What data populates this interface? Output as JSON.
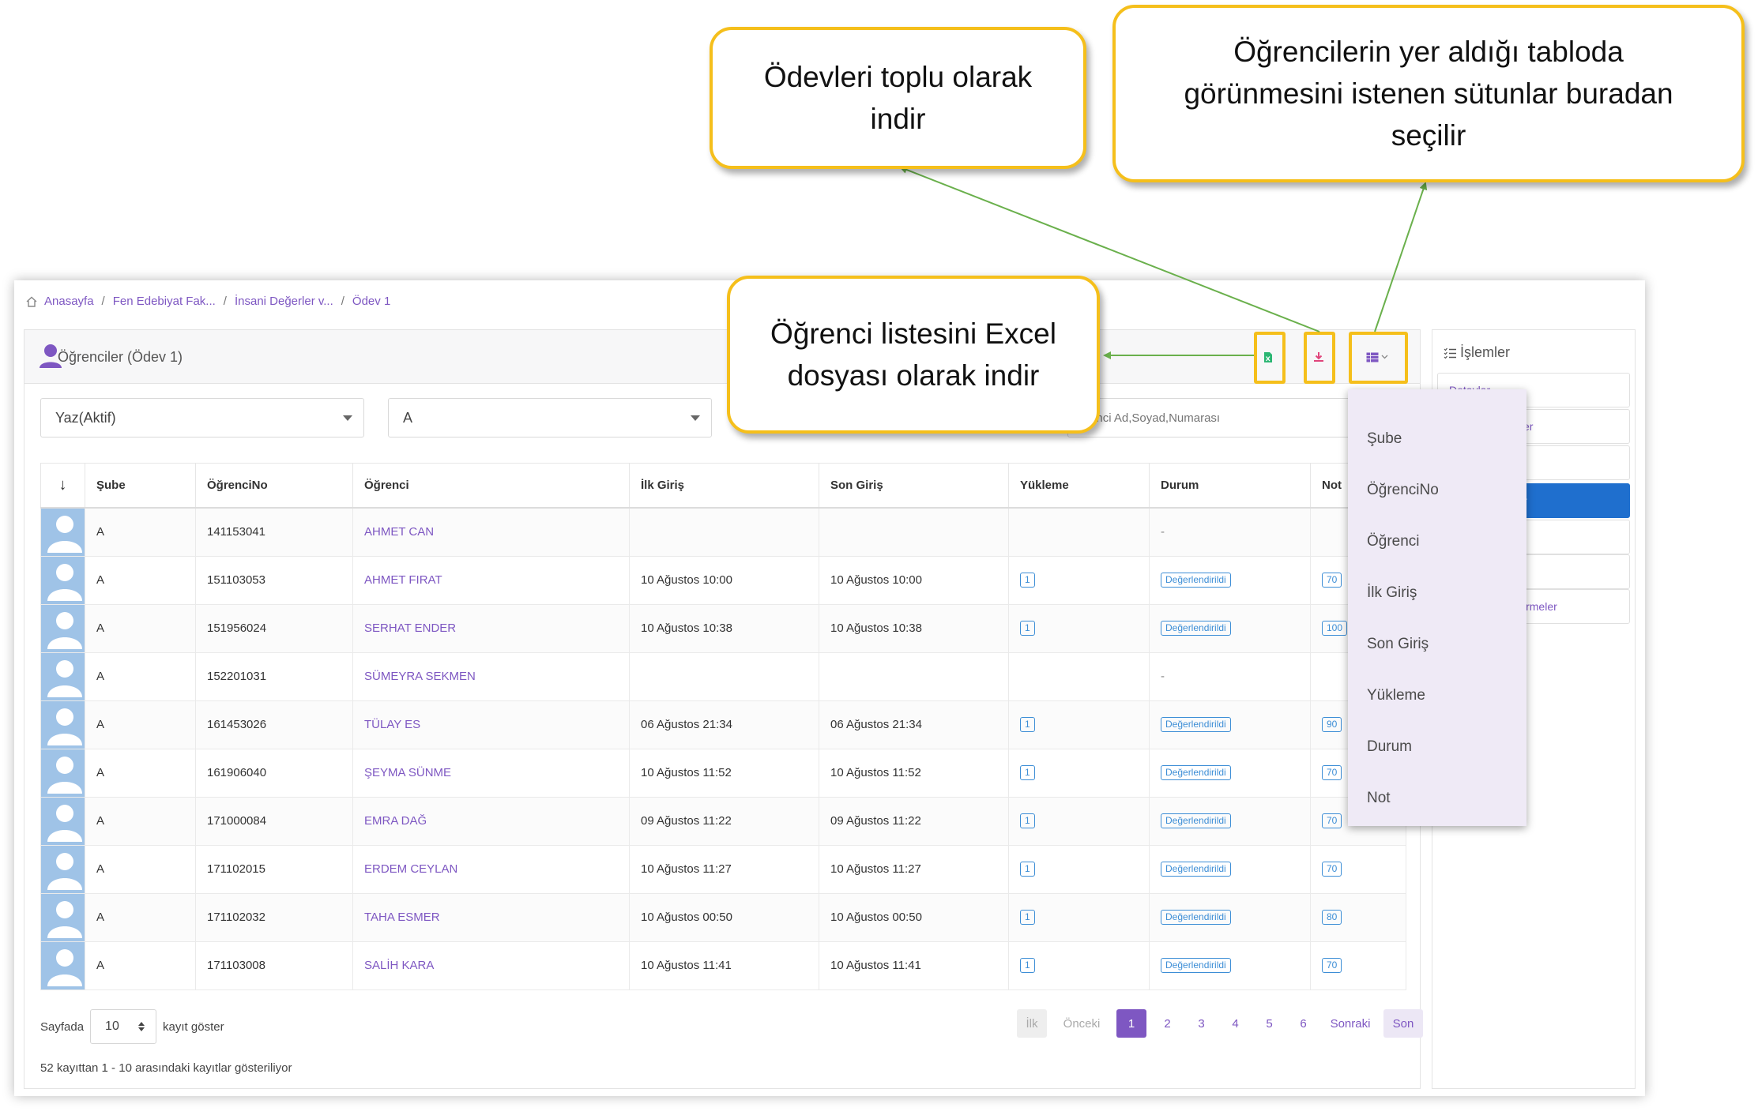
{
  "breadcrumb": [
    "Anasayfa",
    "Fen Edebiyat Fak...",
    "İnsani Değerler v...",
    "Ödev 1"
  ],
  "panel": {
    "title": "Öğrenciler (Ödev 1)"
  },
  "filters": {
    "term": "Yaz(Aktif)",
    "branch": "A",
    "search_placeholder": "Öğrenci Ad,Soyad,Numarası"
  },
  "table": {
    "sort_icon": "↓",
    "headers": [
      "Şube",
      "ÖğrenciNo",
      "Öğrenci",
      "İlk Giriş",
      "Son Giriş",
      "Yükleme",
      "Durum",
      "Not"
    ],
    "rows": [
      {
        "sube": "A",
        "no": "141153041",
        "name": "AHMET CAN",
        "first": "",
        "last": "",
        "upload": "",
        "status": "-",
        "grade": ""
      },
      {
        "sube": "A",
        "no": "151103053",
        "name": "AHMET FIRAT",
        "first": "10 Ağustos 10:00",
        "last": "10 Ağustos 10:00",
        "upload": "1",
        "status": "Değerlendirildi",
        "grade": "70"
      },
      {
        "sube": "A",
        "no": "151956024",
        "name": "SERHAT ENDER",
        "first": "10 Ağustos 10:38",
        "last": "10 Ağustos 10:38",
        "upload": "1",
        "status": "Değerlendirildi",
        "grade": "100"
      },
      {
        "sube": "A",
        "no": "152201031",
        "name": "SÜMEYRA SEKMEN",
        "first": "",
        "last": "",
        "upload": "",
        "status": "-",
        "grade": ""
      },
      {
        "sube": "A",
        "no": "161453026",
        "name": "TÜLAY ES",
        "first": "06 Ağustos 21:34",
        "last": "06 Ağustos 21:34",
        "upload": "1",
        "status": "Değerlendirildi",
        "grade": "90"
      },
      {
        "sube": "A",
        "no": "161906040",
        "name": "ŞEYMA SÜNME",
        "first": "10 Ağustos 11:52",
        "last": "10 Ağustos 11:52",
        "upload": "1",
        "status": "Değerlendirildi",
        "grade": "70"
      },
      {
        "sube": "A",
        "no": "171000084",
        "name": "EMRA DAĞ",
        "first": "09 Ağustos 11:22",
        "last": "09 Ağustos 11:22",
        "upload": "1",
        "status": "Değerlendirildi",
        "grade": "70"
      },
      {
        "sube": "A",
        "no": "171102015",
        "name": "ERDEM CEYLAN",
        "first": "10 Ağustos 11:27",
        "last": "10 Ağustos 11:27",
        "upload": "1",
        "status": "Değerlendirildi",
        "grade": "70"
      },
      {
        "sube": "A",
        "no": "171102032",
        "name": "TAHA ESMER",
        "first": "10 Ağustos 00:50",
        "last": "10 Ağustos 00:50",
        "upload": "1",
        "status": "Değerlendirildi",
        "grade": "80"
      },
      {
        "sube": "A",
        "no": "171103008",
        "name": "SALİH KARA",
        "first": "10 Ağustos 11:41",
        "last": "10 Ağustos 11:41",
        "upload": "1",
        "status": "Değerlendirildi",
        "grade": "70"
      }
    ]
  },
  "footer": {
    "page_size_prefix": "Sayfada",
    "page_size": "10",
    "page_size_suffix": "kayıt göster",
    "record_info": "52 kayıttan 1 - 10 arasındaki kayıtlar gösteriliyor"
  },
  "pagination": {
    "first": "İlk",
    "prev": "Önceki",
    "pages": [
      "1",
      "2",
      "3",
      "4",
      "5",
      "6"
    ],
    "next": "Sonraki",
    "last": "Son"
  },
  "sidebar": {
    "title": "İşlemler",
    "items": [
      "Detaylar",
      "er",
      "",
      "r",
      "",
      "",
      "irmeler"
    ]
  },
  "column_menu": {
    "items": [
      "Şube",
      "ÖğrenciNo",
      "Öğrenci",
      "İlk Giriş",
      "Son Giriş",
      "Yükleme",
      "Durum",
      "Not"
    ]
  },
  "callouts": {
    "bulk_download": [
      "Ödevleri toplu olarak",
      "indir"
    ],
    "columns": [
      "Öğrencilerin yer aldığı tabloda",
      "görünmesini istenen sütunlar buradan",
      "seçilir"
    ],
    "excel": [
      "Öğrenci listesini Excel",
      "dosyası olarak indir"
    ]
  },
  "colors": {
    "accent": "#7e57c2",
    "highlight": "#f5bf1b",
    "arrow": "#6ab04c",
    "badge": "#3d8ed6",
    "active_button": "#1f6fce"
  },
  "icons": [
    "home-icon",
    "user-icon",
    "excel-icon",
    "download-icon",
    "columns-icon",
    "chevron-down-icon",
    "sort-arrow-icon",
    "list-icon"
  ]
}
